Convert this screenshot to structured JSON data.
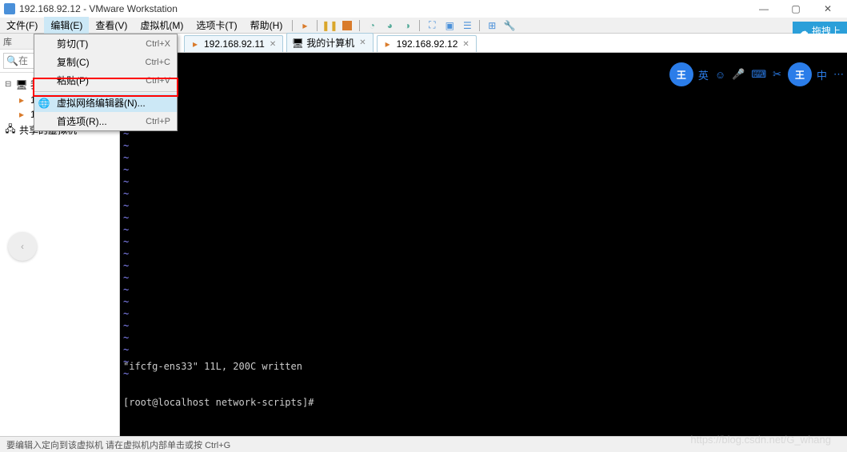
{
  "titlebar": {
    "text": "192.168.92.12 - VMware Workstation"
  },
  "menubar": {
    "items": [
      "文件(F)",
      "编辑(E)",
      "查看(V)",
      "虚拟机(M)",
      "选项卡(T)",
      "帮助(H)"
    ]
  },
  "dropdown": {
    "cut": {
      "label": "剪切(T)",
      "shortcut": "Ctrl+X"
    },
    "copy": {
      "label": "复制(C)",
      "shortcut": "Ctrl+C"
    },
    "paste": {
      "label": "粘贴(P)",
      "shortcut": "Ctrl+V"
    },
    "vnet": {
      "label": "虚拟网络编辑器(N)..."
    },
    "prefs": {
      "label": "首选项(R)...",
      "shortcut": "Ctrl+P"
    }
  },
  "sidebar": {
    "search_placeholder": "在",
    "lib_label": "我",
    "items": [
      {
        "label": "192.168.92.11"
      },
      {
        "label": "192.168.92.12"
      }
    ],
    "shared_label": "共享的虚拟机"
  },
  "tabs": [
    {
      "label": "192.168.92.11",
      "active": false
    },
    {
      "label": "我的计算机",
      "active": false
    },
    {
      "label": "192.168.92.12",
      "active": true
    }
  ],
  "terminal": {
    "line1": "\"ifcfg-ens33\" 11L, 200C written",
    "line2": "[root@localhost network-scripts]# "
  },
  "statusbar": {
    "text": "要编辑入定向到该虚拟机   请在虚拟机内部单击或按 Ctrl+G"
  },
  "watermark": "https://blog.csdn.net/G_whang",
  "sync_btn": "拖拽上",
  "ime": {
    "main": "王",
    "txt": "英",
    "zh": "中"
  }
}
